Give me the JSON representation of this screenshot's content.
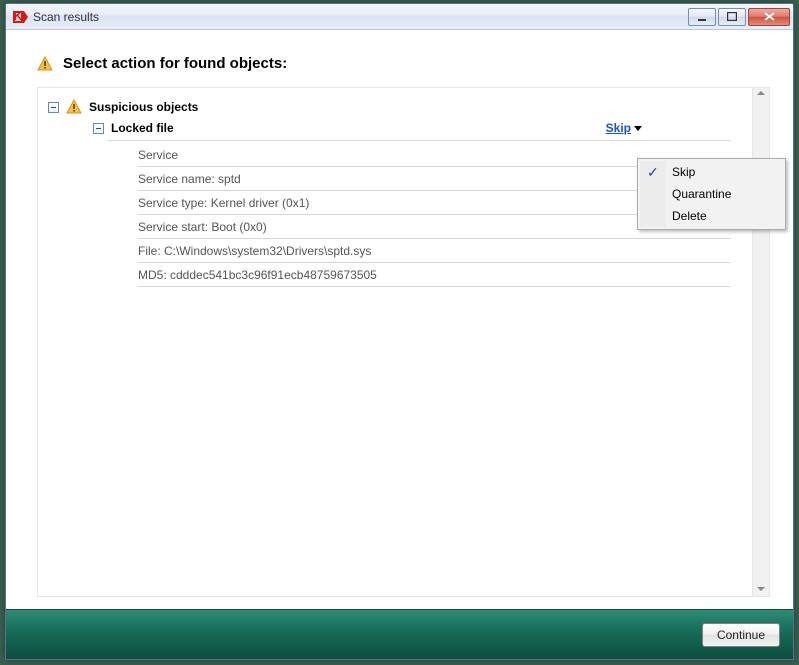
{
  "window": {
    "title": "Scan results"
  },
  "heading": "Select action for found objects:",
  "tree": {
    "category_label": "Suspicious objects",
    "item_label": "Locked file",
    "action_link": "Skip"
  },
  "details": {
    "rows": [
      "Service",
      "Service name: sptd",
      "Service type: Kernel driver (0x1)",
      "Service start: Boot (0x0)",
      "File: C:\\Windows\\system32\\Drivers\\sptd.sys",
      "MD5: cdddec541bc3c96f91ecb48759673505"
    ]
  },
  "dropdown": {
    "items": [
      "Skip",
      "Quarantine",
      "Delete"
    ],
    "selected": "Skip"
  },
  "footer": {
    "continue": "Continue"
  }
}
